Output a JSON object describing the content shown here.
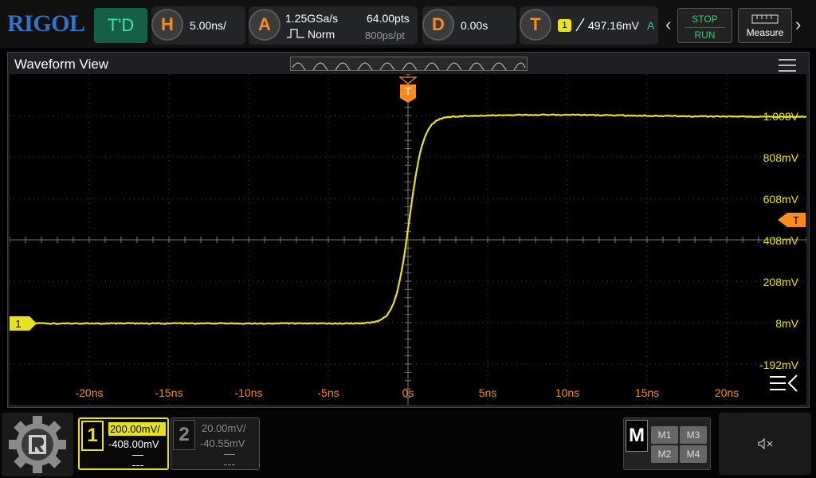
{
  "brand": {
    "logo": "RIGOL"
  },
  "top_bar": {
    "mode_label": "T'D",
    "horizontal": {
      "badge": "H",
      "scale": "5.00ns/"
    },
    "acquire": {
      "badge": "A",
      "sample_rate": "1.25GSa/s",
      "mode": "Norm",
      "points": "64.00pts",
      "interval": "800ps/pt"
    },
    "delay": {
      "badge": "D",
      "value": "0.00s"
    },
    "trigger": {
      "badge": "T",
      "channel": "1",
      "level": "497.16mV",
      "mode": "A"
    },
    "run_control": {
      "stop": "STOP",
      "run": "RUN"
    },
    "measure_label": "Measure"
  },
  "waveform_window": {
    "title": "Waveform View",
    "trigger_marker": "T",
    "right_trigger_marker": "T",
    "channel_marker": "1",
    "y_ticks": [
      "1.008V",
      "808mV",
      "608mV",
      "408mV",
      "208mV",
      "8mV",
      "-192mV"
    ],
    "x_ticks": [
      "-20ns",
      "-15ns",
      "-10ns",
      "-5ns",
      "0s",
      "5ns",
      "10ns",
      "15ns",
      "20ns"
    ]
  },
  "channels": [
    {
      "number": "1",
      "scale": "200.00mV/",
      "offset": "-408.00mV",
      "active": true
    },
    {
      "number": "2",
      "scale": "20.00mV/",
      "offset": "-40.55mV",
      "active": false
    }
  ],
  "math": {
    "label": "M",
    "buttons": [
      "M1",
      "M3",
      "M2",
      "M4"
    ]
  },
  "colors": {
    "ch1": "#e8e21e",
    "ch2": "#888888",
    "accent_orange": "#ff8a1c",
    "logo_blue": "#2f74c8",
    "run_green": "#35d07a",
    "mode_green": "#155f47"
  },
  "icons": {
    "gear": "rigol-gear-icon",
    "sound": "speaker-muted-icon",
    "menu": "hamburger-menu-icon",
    "collapse": "collapse-menu-icon"
  }
}
